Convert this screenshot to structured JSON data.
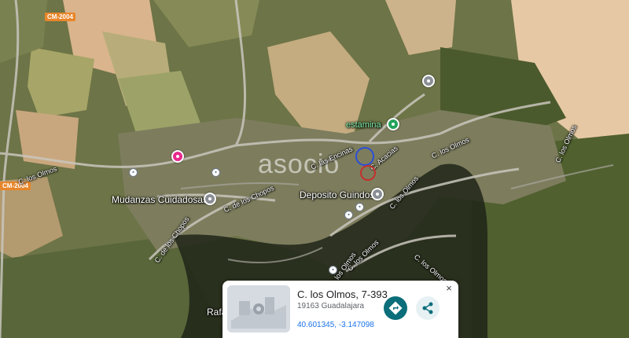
{
  "map": {
    "watermark": "asocio",
    "road_shields": [
      "CM-2004",
      "CM-2004"
    ],
    "street_labels": {
      "los_olmos_left": "C. los Olmos",
      "los_olmos_right1": "C. los Olmos",
      "los_olmos_right2": "C. los Olmos",
      "los_olmos_center": "C. los Olmos",
      "los_olmos_bottom1": "C. los Olmos",
      "los_olmos_bottom2": "C. los Olmos",
      "los_olmos_bottom3": "C. los Olmos",
      "de_los_chopos_1": "C. de los Chopos",
      "de_los_chopos_2": "C. de los Chopos",
      "las_encinas": "C. las Encinas",
      "acacias": "C. Acacias",
      "rafa": "Rafa"
    },
    "places": {
      "estamina": "estamina",
      "deposito": "Deposito Guindos",
      "mudanzas": "Mudanzas Cuidadosas"
    },
    "colors": {
      "estamina_text": "#7ef0a8",
      "pin_green": "#22a35a",
      "pin_grey": "#8a8f95",
      "pin_pink": "#e8288e",
      "road_shield": "#e8862a"
    }
  },
  "info_card": {
    "address": "C. los Olmos, 7-393",
    "city": "19163 Guadalajara",
    "coordinates": "40.601345, -3.147098",
    "close_label": "×"
  }
}
